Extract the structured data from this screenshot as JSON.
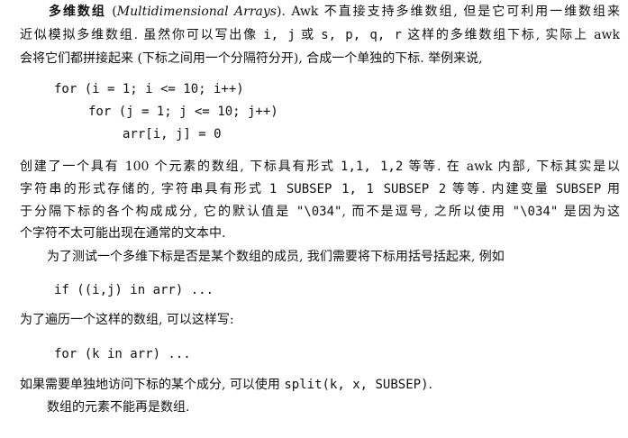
{
  "intro": {
    "heading_cn": "多维数组",
    "heading_en_pre": " (",
    "heading_en": "Multidimensional Arrays",
    "heading_en_post": "). ",
    "l1_rest": "Awk 不直接支持多维数组, 但是它可利用一维数组来",
    "l2_a": "近似模拟多维数组. 虽然你可以写出像 ",
    "l2_code1": "i, j",
    "l2_b": " 或 ",
    "l2_code2": "s, p, q, r",
    "l2_c": " 这样的多维数组下标, 实际上 awk",
    "l3": "会将它们都拼接起来 (下标之间用一个分隔符分开), 合成一个单独的下标. 举例来说,"
  },
  "code_block_1": {
    "line1": "for (i = 1; i <= 10; i++)",
    "line2": "for (j = 1; j <= 10; j++)",
    "line3": "arr[i, j] = 0"
  },
  "para2": {
    "l1_a": "创建了一个具有 100 个元素的数组, 下标具有形式 ",
    "l1_code": "1,1, 1,2",
    "l1_b": " 等等. 在 awk 内部, 下标其实是以",
    "l2_a": "字符串的形式存储的, 字符串具有形式 ",
    "l2_code": "1 SUBSEP 1, 1 SUBSEP 2",
    "l2_b": " 等等. 内建变量 ",
    "l2_code2": "SUBSEP",
    "l2_c": " 用",
    "l3_a": "于分隔下标的各个构成成分, 它的默认值是 ",
    "l3_code1": "\"\\034\"",
    "l3_b": ", 而不是逗号, 之所以使用 ",
    "l3_code2": "\"\\034\"",
    "l3_c": " 是因为这",
    "l4": "个字符不太可能出现在通常的文本中."
  },
  "para3": {
    "text": "为了测试一个多维下标是否是某个数组的成员, 我们需要将下标用括号括起来, 例如",
    "code": "if ((i,j) in arr) ..."
  },
  "para4": {
    "text": "为了遍历一个这样的数组, 可以这样写:",
    "code": "for (k in arr) ..."
  },
  "para5": {
    "text_a": "如果需要单独地访问下标的某个成分, 可以使用 ",
    "code": "split(k, x, SUBSEP)",
    "text_b": ".",
    "last": "数组的元素不能再是数组."
  }
}
